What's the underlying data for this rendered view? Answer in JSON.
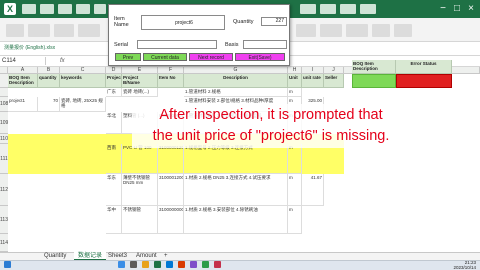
{
  "window": {
    "file_tab_label": "测量报价 (English).xlsx",
    "minimize_glyph": "−",
    "maximize_glyph": "□",
    "close_glyph": "×"
  },
  "formula_bar": {
    "name_box": "C114",
    "fx_label": "fx"
  },
  "dialog": {
    "item_label": "Item\nName",
    "item_value": "project6",
    "quantity_label": "Quantity",
    "quantity_value": "227",
    "serial_label": "Serial",
    "serial_value": "",
    "basis_label": "Basis",
    "basis_value": "",
    "buttons": [
      {
        "label": "Prev",
        "color": "#7ed957"
      },
      {
        "label": "Current data",
        "color": "#7ed957"
      },
      {
        "label": "Next record",
        "color": "#f040f0"
      },
      {
        "label": "Exit(Save)",
        "color": "#f040f0"
      }
    ]
  },
  "sheet": {
    "columns": [
      "A",
      "B",
      "C",
      "D",
      "E",
      "F",
      "G",
      "H",
      "I",
      "J",
      "K"
    ],
    "headers": [
      "BOQ Item\nDescription",
      "quantity",
      "keywords",
      "Project",
      "Project B/Name",
      "Item No",
      "Description",
      "Unit",
      "unit rate",
      "Seller"
    ],
    "right_headers": [
      "BOQ Item\nDescription",
      "Error Status"
    ],
    "row_numbers": [
      "",
      "108",
      "109",
      "110",
      "111",
      "112",
      "113",
      "114"
    ],
    "rows": [
      {
        "num": "",
        "a": "",
        "b": "",
        "c": "",
        "d": "广东",
        "e": "瓷砖 地砖(...)",
        "f": "",
        "g": "1.管道材料 2.规格",
        "h": "m",
        "i": "",
        "j": ""
      },
      {
        "num": "108",
        "a": "project1",
        "b": "70",
        "c": "瓷砖, 地砖, 25X25 规格",
        "d": "",
        "e": "",
        "f": "",
        "g": "1.管道材料安装 2.部位/规格 3.材料品种/厚度",
        "h": "m",
        "i": "325.00",
        "j": ""
      },
      {
        "num": "109",
        "a": "",
        "b": "",
        "c": "",
        "d": "华北",
        "e": "塑料管 (...)",
        "f": "00000000012",
        "g": "1.管道材料安装 2.安装部位 3.规格型号",
        "h": "m",
        "i": "",
        "j": ""
      },
      {
        "num": "110",
        "a": "",
        "b": "",
        "c": "",
        "d": "",
        "e": "",
        "f": "",
        "g": "",
        "h": "",
        "i": "",
        "j": ""
      },
      {
        "num": "111",
        "a": "",
        "b": "",
        "c": "",
        "d": "西南",
        "e": "PVC-U 管 100",
        "f": "310000012001",
        "g": "1.规格型号 2.压力等级 3.连接方式",
        "h": "m",
        "i": "",
        "j": ""
      },
      {
        "num": "112",
        "a": "",
        "b": "",
        "c": "",
        "d": "华东",
        "e": "薄壁不锈钢管 DN25 mm",
        "f": "310000120002",
        "g": "1.材质 2.规格 DN25 3.连接方式 4.试压要求",
        "h": "m",
        "i": "41.67",
        "j": ""
      },
      {
        "num": "113",
        "a": "",
        "b": "",
        "c": "",
        "d": "华中",
        "e": "不锈钢管",
        "f": "310000000002",
        "g": "1.材质 2.规格 3.安装部位 4.除锈刷油",
        "h": "m",
        "i": "",
        "j": ""
      },
      {
        "num": "114",
        "a": "",
        "b": "",
        "c": "",
        "d": "",
        "e": "",
        "f": "",
        "g": "",
        "h": "",
        "i": "",
        "j": ""
      }
    ],
    "tabs": [
      "Quantity",
      "数据记录",
      "Sheet3",
      "Amount"
    ],
    "active_tab_index": 1,
    "add_tab_glyph": "+"
  },
  "overlay": {
    "line1": "After inspection, it is prompted that",
    "line2": "the unit price of \"project6\" is missing."
  },
  "taskbar": {
    "time": "21:23",
    "date": "2023/10/14"
  }
}
